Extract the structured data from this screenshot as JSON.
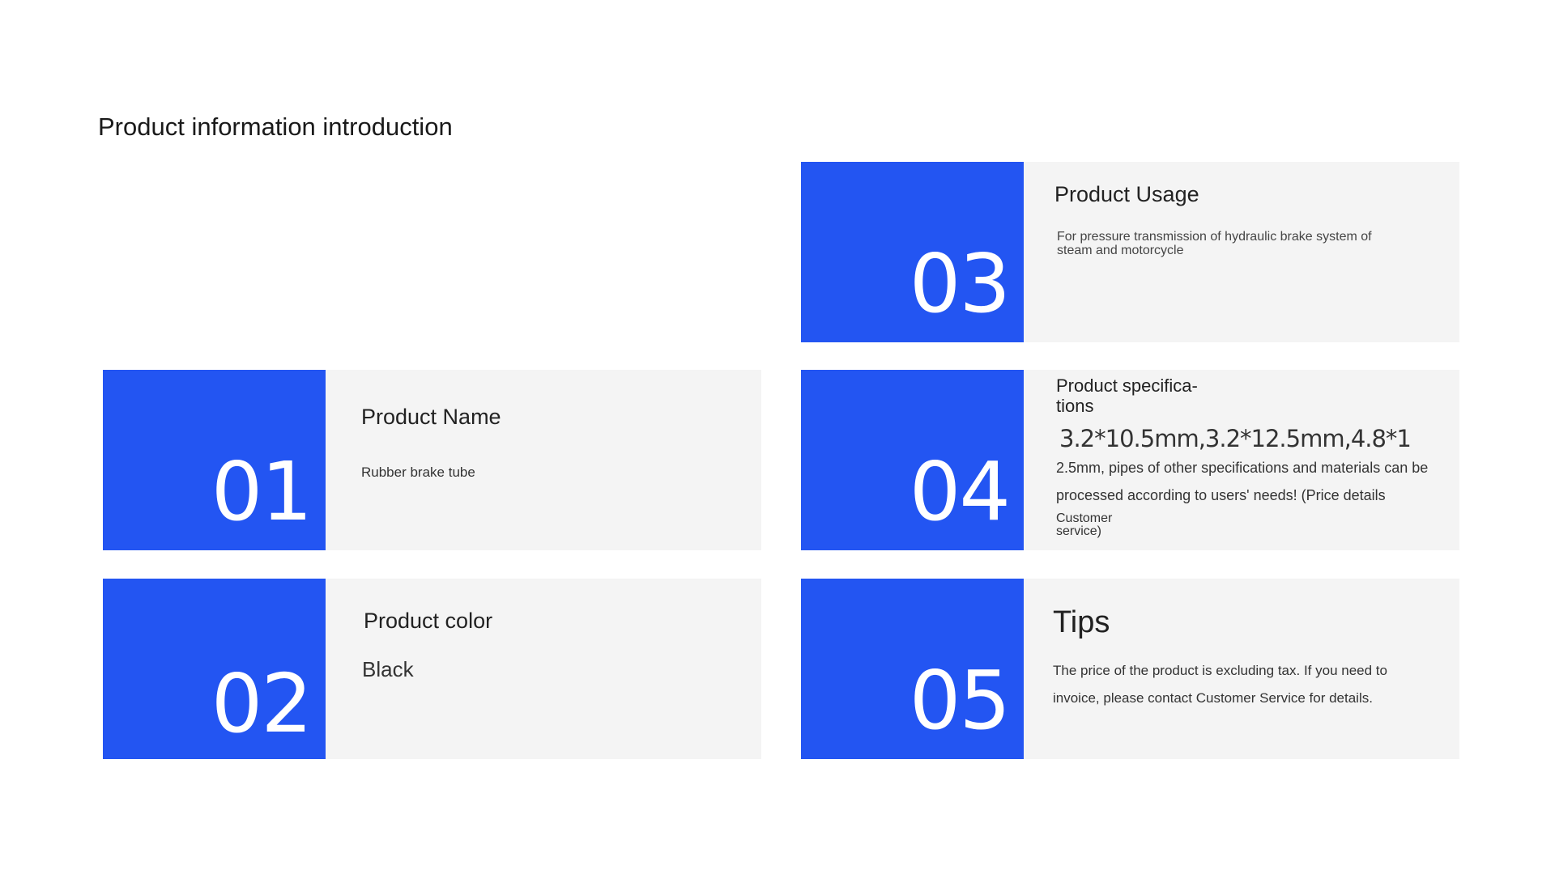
{
  "page": {
    "title": "Product information introduction"
  },
  "colors": {
    "accent": "#2355f2",
    "card_bg": "#f4f4f4"
  },
  "cards": [
    {
      "number": "01",
      "heading": "Product Name",
      "body": "Rubber brake tube"
    },
    {
      "number": "02",
      "heading": "Product color",
      "body": "Black"
    },
    {
      "number": "03",
      "heading": "Product Usage",
      "body": "For pressure transmission of hydraulic brake system of steam and motorcycle"
    },
    {
      "number": "04",
      "heading": "Product specifica- tions",
      "sizes": "3.2*10.5mm,3.2*12.5mm,4.8*1",
      "detail": "2.5mm, pipes of other specifications and materials can be processed according to users' needs! (Price details",
      "service": "Customer service)"
    },
    {
      "number": "05",
      "heading": "Tips",
      "body": "The price of the product is excluding tax. If you need to invoice, please contact Customer Service for details."
    }
  ]
}
